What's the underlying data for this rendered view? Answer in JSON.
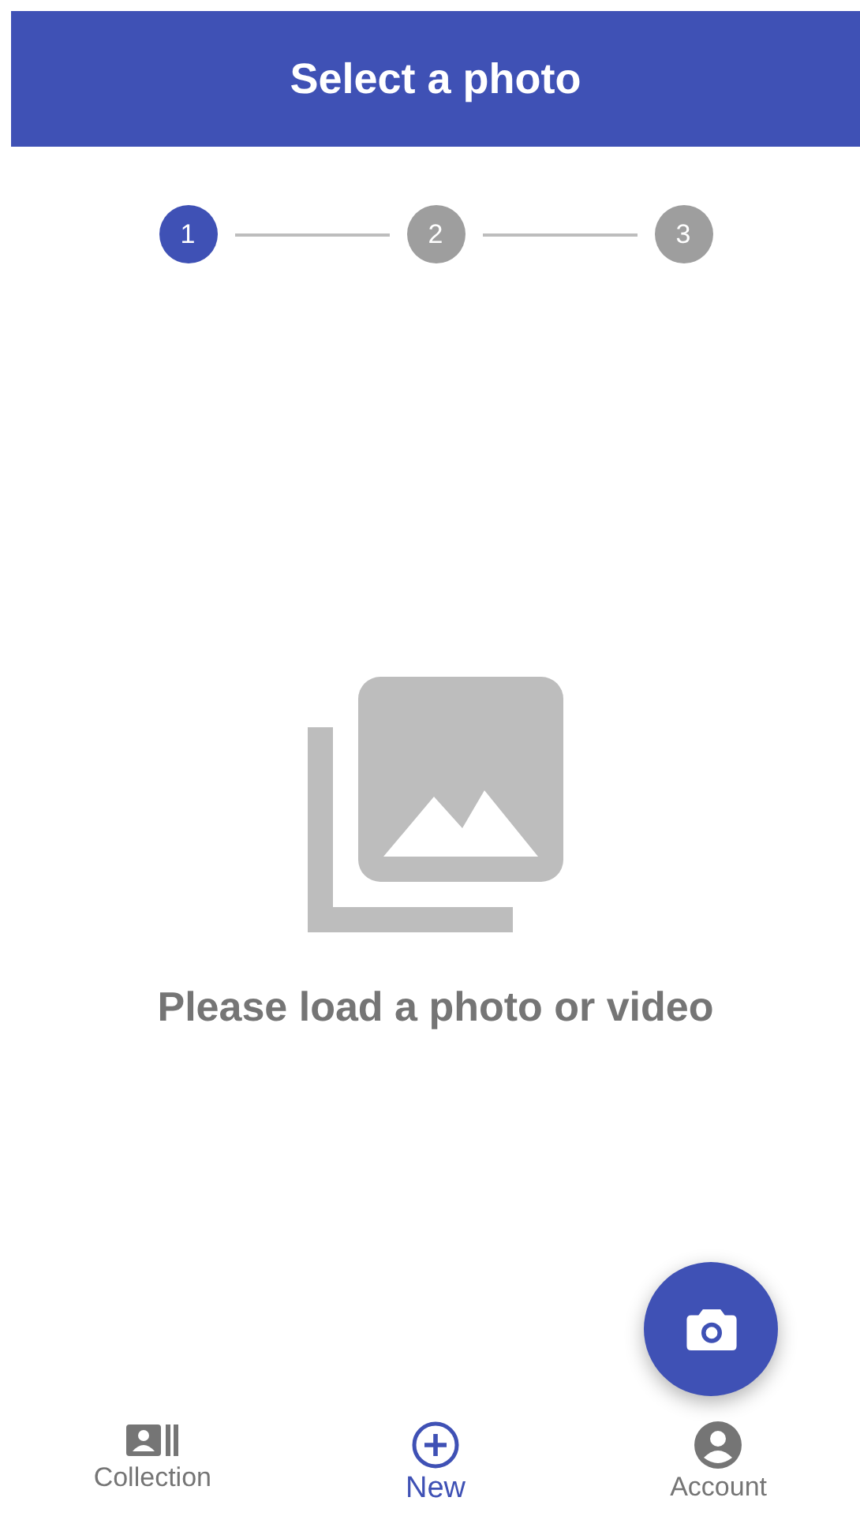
{
  "app_bar": {
    "title": "Select a photo"
  },
  "steps": [
    {
      "label": "1",
      "selected": true
    },
    {
      "label": "2",
      "selected": false
    },
    {
      "label": "3",
      "selected": false
    }
  ],
  "empty_state": {
    "message": "Please load a photo or video"
  },
  "fab": {
    "kind": "camera"
  },
  "bottom_nav": [
    {
      "label": "Collection",
      "kind": "collection",
      "selected": false
    },
    {
      "label": "New",
      "kind": "new",
      "selected": true
    },
    {
      "label": "Account",
      "kind": "account",
      "selected": false
    }
  ]
}
